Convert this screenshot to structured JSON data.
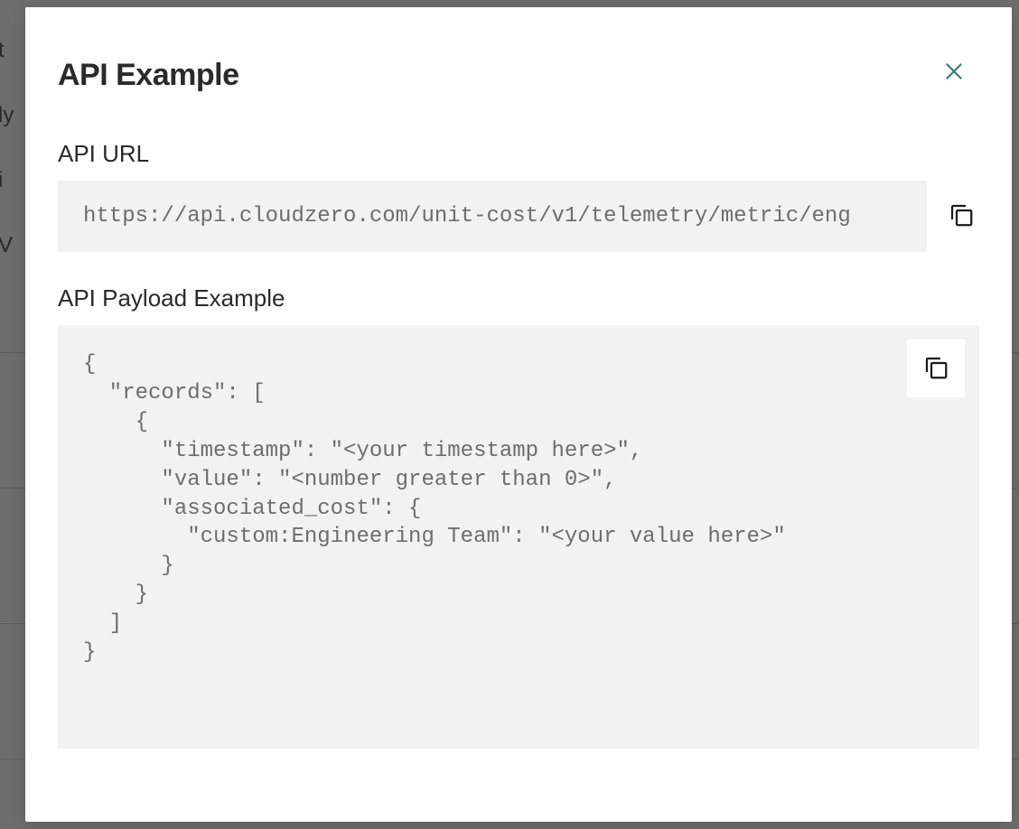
{
  "modal": {
    "title": "API Example",
    "url_label": "API URL",
    "url_value": "https://api.cloudzero.com/unit-cost/v1/telemetry/metric/eng",
    "payload_label": "API Payload Example",
    "payload_value": "{\n  \"records\": [\n    {\n      \"timestamp\": \"<your timestamp here>\",\n      \"value\": \"<number greater than 0>\",\n      \"associated_cost\": {\n        \"custom:Engineering Team\": \"<your value here>\"\n      }\n    }\n  ]\n}"
  },
  "background": {
    "t1": "t",
    "t2": "ly",
    "t3": "i",
    "t4": "V"
  }
}
